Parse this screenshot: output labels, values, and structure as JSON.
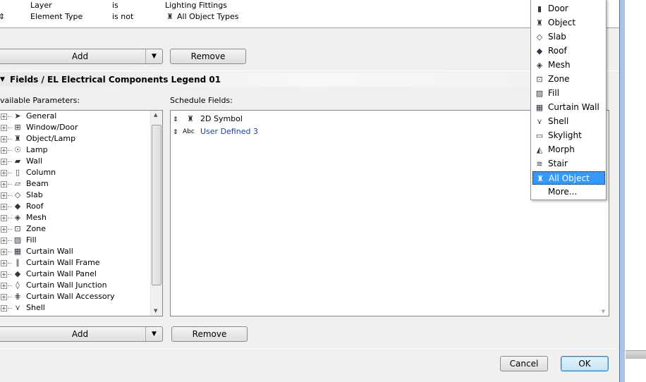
{
  "criteria": [
    {
      "field": "Layer",
      "op": "is",
      "value": "Lighting Fittings"
    },
    {
      "field": "Element Type",
      "op": "is not",
      "value": "All Object Types",
      "icon": "object-icon"
    }
  ],
  "criteria_buttons": {
    "add": "Add",
    "remove": "Remove"
  },
  "fields_header": "Fields / EL Electrical Components Legend 01",
  "available_label": "vailable Parameters:",
  "schedule_label": "Schedule Fields:",
  "available": [
    {
      "label": "General",
      "icon": "cursor-icon"
    },
    {
      "label": "Window/Door",
      "icon": "window-icon"
    },
    {
      "label": "Object/Lamp",
      "icon": "object-icon"
    },
    {
      "label": "Lamp",
      "icon": "lamp-icon"
    },
    {
      "label": "Wall",
      "icon": "wall-icon"
    },
    {
      "label": "Column",
      "icon": "column-icon"
    },
    {
      "label": "Beam",
      "icon": "beam-icon"
    },
    {
      "label": "Slab",
      "icon": "slab-icon"
    },
    {
      "label": "Roof",
      "icon": "roof-icon"
    },
    {
      "label": "Mesh",
      "icon": "mesh-icon"
    },
    {
      "label": "Zone",
      "icon": "zone-icon"
    },
    {
      "label": "Fill",
      "icon": "fill-icon"
    },
    {
      "label": "Curtain Wall",
      "icon": "curtain-wall-icon"
    },
    {
      "label": "Curtain Wall Frame",
      "icon": "cw-frame-icon"
    },
    {
      "label": "Curtain Wall Panel",
      "icon": "cw-panel-icon"
    },
    {
      "label": "Curtain Wall Junction",
      "icon": "cw-junction-icon"
    },
    {
      "label": "Curtain Wall Accessory",
      "icon": "cw-accessory-icon"
    },
    {
      "label": "Shell",
      "icon": "shell-icon"
    }
  ],
  "schedule_fields": [
    {
      "label": "2D Symbol",
      "icon": "object-icon",
      "type": ""
    },
    {
      "label": "User Defined 3",
      "icon": "",
      "type": "Abc"
    }
  ],
  "fields_buttons": {
    "add": "Add",
    "remove": "Remove"
  },
  "footer": {
    "cancel": "Cancel",
    "ok": "OK"
  },
  "dropdown": {
    "items": [
      {
        "label": "Door",
        "icon": "door-icon"
      },
      {
        "label": "Object",
        "icon": "object-icon"
      },
      {
        "label": "Slab",
        "icon": "slab-icon"
      },
      {
        "label": "Roof",
        "icon": "roof-icon"
      },
      {
        "label": "Mesh",
        "icon": "mesh-icon"
      },
      {
        "label": "Zone",
        "icon": "zone-icon"
      },
      {
        "label": "Fill",
        "icon": "fill-icon"
      },
      {
        "label": "Curtain Wall",
        "icon": "curtain-wall-icon"
      },
      {
        "label": "Shell",
        "icon": "shell-icon"
      },
      {
        "label": "Skylight",
        "icon": "skylight-icon"
      },
      {
        "label": "Morph",
        "icon": "morph-icon"
      },
      {
        "label": "Stair",
        "icon": "stair-icon"
      },
      {
        "label": "All Object Types",
        "icon": "object-icon",
        "selected": true
      },
      {
        "label": "More...",
        "icon": ""
      }
    ],
    "selected_color": "#3399ff"
  }
}
